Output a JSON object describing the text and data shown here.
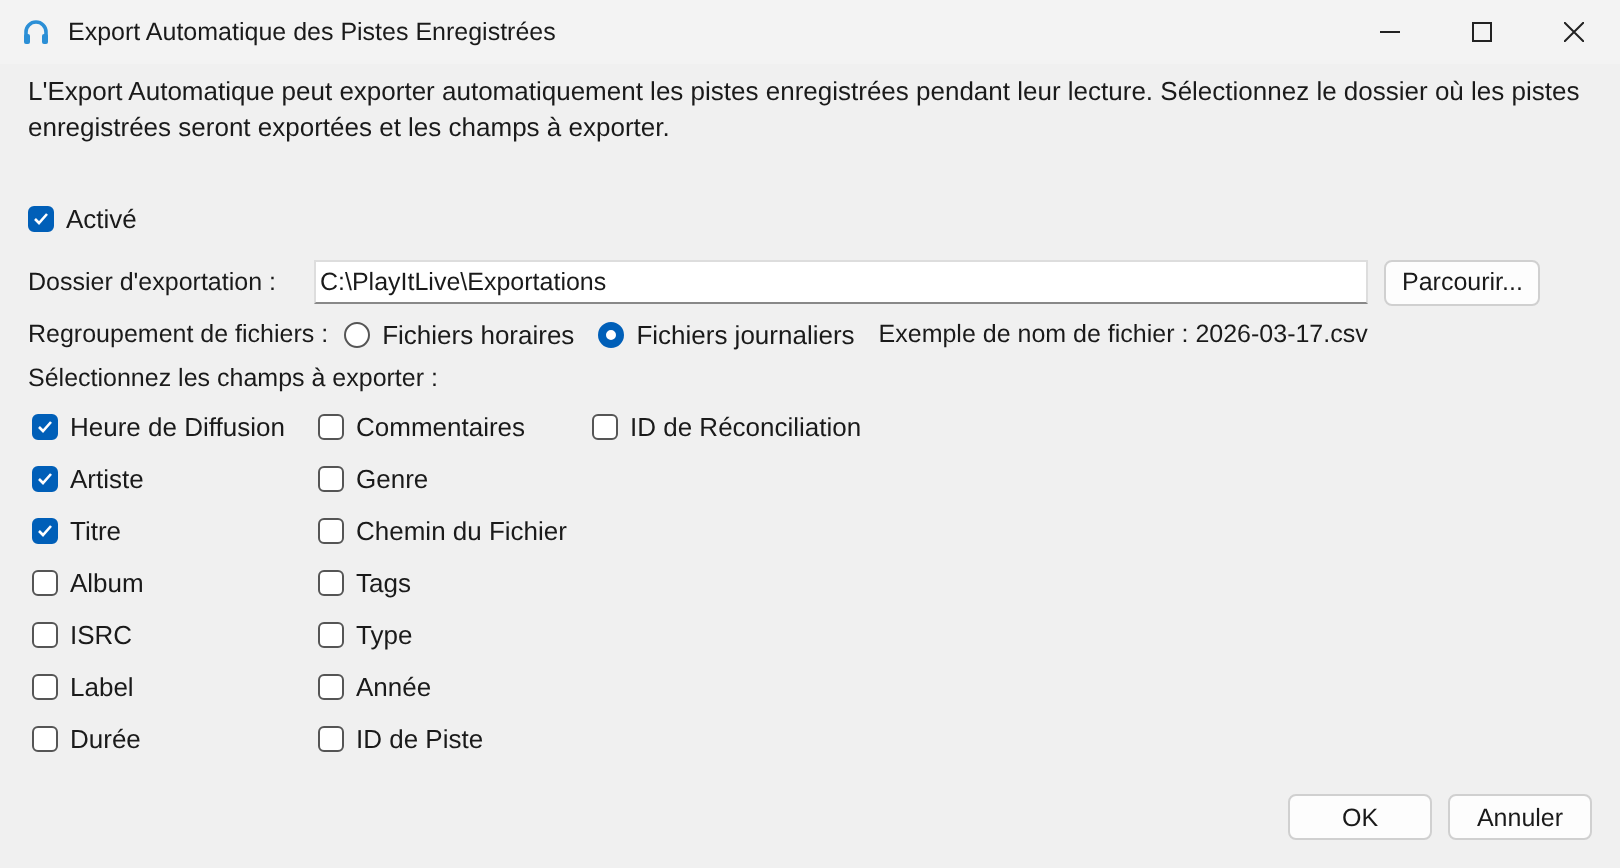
{
  "window": {
    "title": "Export Automatique des Pistes Enregistrées"
  },
  "description": "L'Export Automatique peut exporter automatiquement les pistes enregistrées pendant leur lecture. Sélectionnez le dossier où les pistes enregistrées seront exportées et les champs à exporter.",
  "enabled": {
    "label": "Activé",
    "checked": true
  },
  "folder": {
    "label": "Dossier d'exportation :",
    "value": "C:\\PlayItLive\\Exportations",
    "browse": "Parcourir..."
  },
  "grouping": {
    "label": "Regroupement de fichiers :",
    "options": [
      {
        "label": "Fichiers horaires",
        "selected": false
      },
      {
        "label": "Fichiers journaliers",
        "selected": true
      }
    ],
    "example": "Exemple de nom de fichier : 2026-03-17.csv"
  },
  "fields_label": "Sélectionnez les champs à exporter :",
  "field_columns": [
    [
      {
        "label": "Heure de Diffusion",
        "checked": true
      },
      {
        "label": "Artiste",
        "checked": true
      },
      {
        "label": "Titre",
        "checked": true
      },
      {
        "label": "Album",
        "checked": false
      },
      {
        "label": "ISRC",
        "checked": false
      },
      {
        "label": "Label",
        "checked": false
      },
      {
        "label": "Durée",
        "checked": false
      }
    ],
    [
      {
        "label": "Commentaires",
        "checked": false
      },
      {
        "label": "Genre",
        "checked": false
      },
      {
        "label": "Chemin du Fichier",
        "checked": false
      },
      {
        "label": "Tags",
        "checked": false
      },
      {
        "label": "Type",
        "checked": false
      },
      {
        "label": "Année",
        "checked": false
      },
      {
        "label": "ID de Piste",
        "checked": false
      }
    ],
    [
      {
        "label": "ID de Réconciliation",
        "checked": false
      }
    ]
  ],
  "buttons": [
    "OK",
    "Annuler"
  ]
}
